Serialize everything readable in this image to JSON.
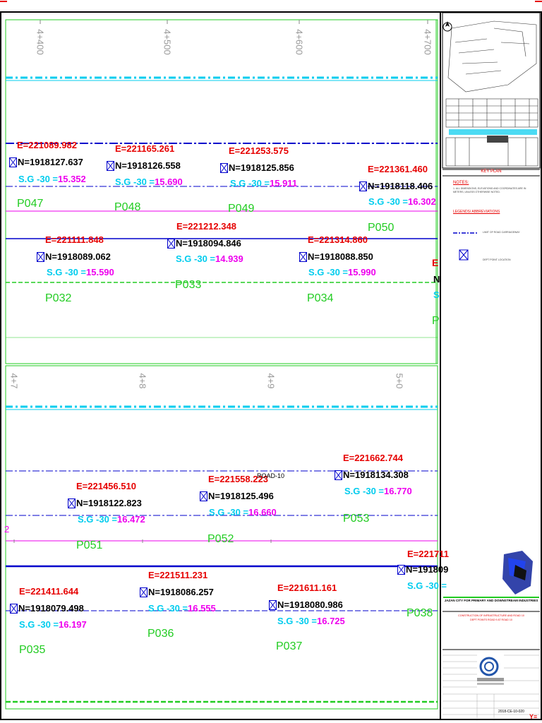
{
  "drawing": {
    "top_chainage": [
      "4+400",
      "4+500",
      "4+600",
      "4+700"
    ],
    "bottom_chainage": [
      "4+7",
      "4+8",
      "4+9",
      "5+0"
    ],
    "road_label": "ROAD-10",
    "points": [
      {
        "id": "P047",
        "e": "E=221089.982",
        "n": "N=1918127.637",
        "sg": "S.G -30 =15.352"
      },
      {
        "id": "P048",
        "e": "E=221165.261",
        "n": "N=1918126.558",
        "sg": "S.G -30 =15.690"
      },
      {
        "id": "P049",
        "e": "E=221253.575",
        "n": "N=1918125.856",
        "sg": "S.G -30 =15.911"
      },
      {
        "id": "P050",
        "e": "E=221361.460",
        "n": "N=1918118.406",
        "sg": "S.G -30 =16.302"
      },
      {
        "id": "P032",
        "e": "E=221111.848",
        "n": "N=1918089.062",
        "sg": "S.G -30 =15.590"
      },
      {
        "id": "P033",
        "e": "E=221212.348",
        "n": "N=1918094.846",
        "sg": "S.G -30 =14.939"
      },
      {
        "id": "P034",
        "e": "E=221314.860",
        "n": "N=1918088.850",
        "sg": "S.G -30 =15.990"
      },
      {
        "id": "P051",
        "e": "E=221456.510",
        "n": "N=1918122.823",
        "sg": "S.G -30 =16.472"
      },
      {
        "id": "P052",
        "e": "E=221558.223",
        "n": "N=1918125.496",
        "sg": "S.G -30 =16.660"
      },
      {
        "id": "P053",
        "e": "E=221662.744",
        "n": "N=1918134.308",
        "sg": "S.G -30 =16.770"
      },
      {
        "id": "P035",
        "e": "E=221411.644",
        "n": "N=1918079.498",
        "sg": "S.G -30 =16.197"
      },
      {
        "id": "P036",
        "e": "E=221511.231",
        "n": "N=1918086.257",
        "sg": "S.G -30 =16.555"
      },
      {
        "id": "P037",
        "e": "E=221611.161",
        "n": "N=1918080.986",
        "sg": "S.G -30 =16.725"
      },
      {
        "id": "P038",
        "e": "E=221711",
        "n": "N=191809",
        "sg": "S.G -30 ="
      }
    ],
    "partial_left_label": "2",
    "partial_right_top": {
      "e": "E",
      "n": "N",
      "sg": "S",
      "p": "P"
    }
  },
  "legend": {
    "key_plan": "KEY PLAN",
    "notes_title": "NOTES:",
    "notes_text": "1. ALL DIMENSIONS, ELEVATIONS AND COORDINATES ARE IN METERS, UNLESS OTHERWISE NOTED.",
    "legend_title": "LEGENDS/ ABBREVIATIONS",
    "limit_label": "LIMIT OF ROAD CARRIAGEWAY",
    "point_label": "DEPT POINT LOCATION"
  },
  "title_block": {
    "logo_line1": "JAZAN CITY FOR PRIMARY AND DOWNSTREAM INDUSTRIES",
    "project_line1": "CONSTRUCTION OF INFRASTRUCTURE AND ROAD 10",
    "project_line2": "DEPT POINTS ROAD 9 AT ROAD 10",
    "drawing_no": "2018-CE-10-020",
    "footer_mark": "Y≡"
  },
  "colors": {
    "green": "#22cc22",
    "red": "#e60000",
    "cyan": "#00ccee",
    "magenta": "#ee00ee",
    "blue": "#0000cc",
    "frame": "#000000"
  }
}
